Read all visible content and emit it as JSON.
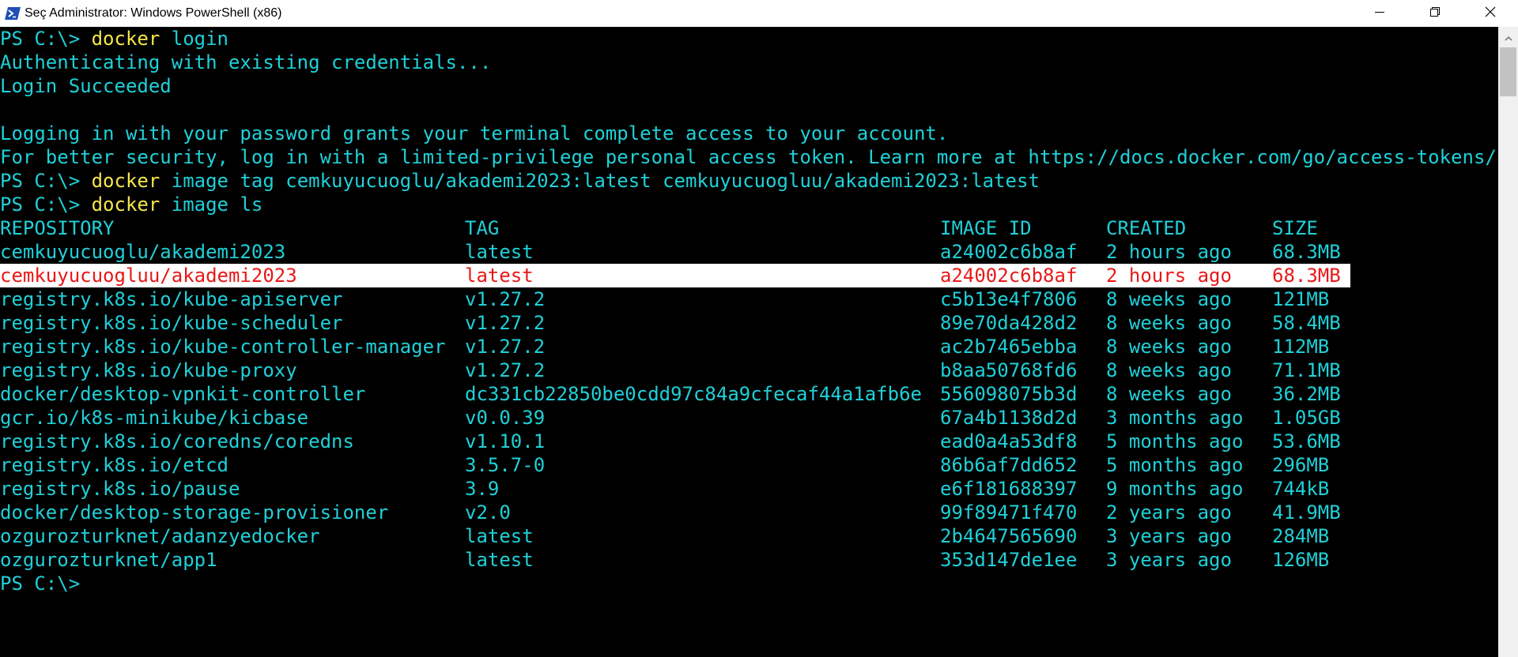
{
  "window": {
    "title": "Seç Administrator: Windows PowerShell (x86)",
    "icons": {
      "app": "powershell-icon",
      "minimize": "minimize-icon",
      "maximize": "restore-icon",
      "close": "close-icon"
    }
  },
  "colors": {
    "background": "#000000",
    "text": "#20d0d8",
    "command": "#f5e64a",
    "highlight_bg": "#ffffff",
    "highlight_text": "#e81818"
  },
  "terminal": {
    "prompt": "PS C:\\>",
    "lines": [
      {
        "prompt": "PS C:\\> ",
        "cmd": "docker",
        "args": " login"
      },
      {
        "text": "Authenticating with existing credentials..."
      },
      {
        "text": "Login Succeeded"
      },
      {
        "text": ""
      },
      {
        "text": "Logging in with your password grants your terminal complete access to your account."
      },
      {
        "text": "For better security, log in with a limited-privilege personal access token. Learn more at https://docs.docker.com/go/access-tokens/"
      },
      {
        "prompt": "PS C:\\> ",
        "cmd": "docker",
        "args": " image tag cemkuyucuoglu/akademi2023:latest cemkuyucuogluu/akademi2023:latest"
      },
      {
        "prompt": "PS C:\\> ",
        "cmd": "docker",
        "args": " image ls"
      }
    ],
    "table": {
      "headers": [
        "REPOSITORY",
        "TAG",
        "IMAGE ID",
        "CREATED",
        "SIZE"
      ],
      "rows": [
        [
          "cemkuyucuoglu/akademi2023",
          "latest",
          "a24002c6b8af",
          "2 hours ago",
          "68.3MB"
        ],
        [
          "cemkuyucuogluu/akademi2023",
          "latest",
          "a24002c6b8af",
          "2 hours ago",
          "68.3MB"
        ],
        [
          "registry.k8s.io/kube-apiserver",
          "v1.27.2",
          "c5b13e4f7806",
          "8 weeks ago",
          "121MB"
        ],
        [
          "registry.k8s.io/kube-scheduler",
          "v1.27.2",
          "89e70da428d2",
          "8 weeks ago",
          "58.4MB"
        ],
        [
          "registry.k8s.io/kube-controller-manager",
          "v1.27.2",
          "ac2b7465ebba",
          "8 weeks ago",
          "112MB"
        ],
        [
          "registry.k8s.io/kube-proxy",
          "v1.27.2",
          "b8aa50768fd6",
          "8 weeks ago",
          "71.1MB"
        ],
        [
          "docker/desktop-vpnkit-controller",
          "dc331cb22850be0cdd97c84a9cfecaf44a1afb6e",
          "556098075b3d",
          "8 weeks ago",
          "36.2MB"
        ],
        [
          "gcr.io/k8s-minikube/kicbase",
          "v0.0.39",
          "67a4b1138d2d",
          "3 months ago",
          "1.05GB"
        ],
        [
          "registry.k8s.io/coredns/coredns",
          "v1.10.1",
          "ead0a4a53df8",
          "5 months ago",
          "53.6MB"
        ],
        [
          "registry.k8s.io/etcd",
          "3.5.7-0",
          "86b6af7dd652",
          "5 months ago",
          "296MB"
        ],
        [
          "registry.k8s.io/pause",
          "3.9",
          "e6f181688397",
          "9 months ago",
          "744kB"
        ],
        [
          "docker/desktop-storage-provisioner",
          "v2.0",
          "99f89471f470",
          "2 years ago",
          "41.9MB"
        ],
        [
          "ozgurozturknet/adanzyedocker",
          "latest",
          "2b4647565690",
          "3 years ago",
          "284MB"
        ],
        [
          "ozgurozturknet/app1",
          "latest",
          "353d147de1ee",
          "3 years ago",
          "126MB"
        ]
      ],
      "highlighted_row": 1
    },
    "final_prompt": "PS C:\\>"
  }
}
